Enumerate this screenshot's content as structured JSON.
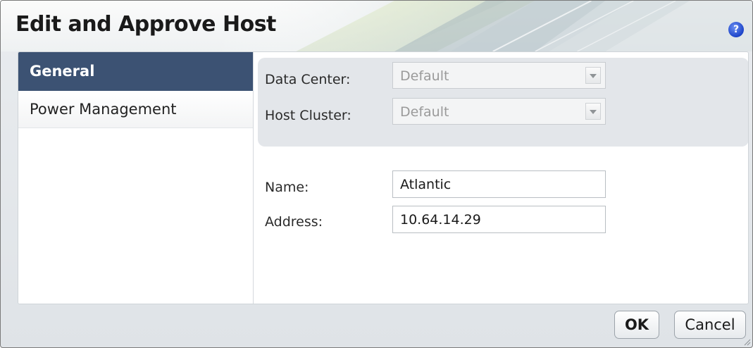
{
  "dialog": {
    "title": "Edit and Approve Host",
    "help_icon": "help-icon",
    "help_glyph": "?"
  },
  "sidebar": {
    "items": [
      {
        "label": "General",
        "active": true
      },
      {
        "label": "Power Management",
        "active": false
      }
    ]
  },
  "cluster": {
    "data_center_label": "Data Center:",
    "data_center_value": "Default",
    "host_cluster_label": "Host Cluster:",
    "host_cluster_value": "Default"
  },
  "host": {
    "name_label": "Name:",
    "name_value": "Atlantic",
    "address_label": "Address:",
    "address_value": "10.64.14.29"
  },
  "buttons": {
    "ok_label": "OK",
    "cancel_label": "Cancel"
  },
  "colors": {
    "active_tab": "#3c5273",
    "help_icon": "#1d44c9",
    "panel": "#e3e6ea"
  }
}
